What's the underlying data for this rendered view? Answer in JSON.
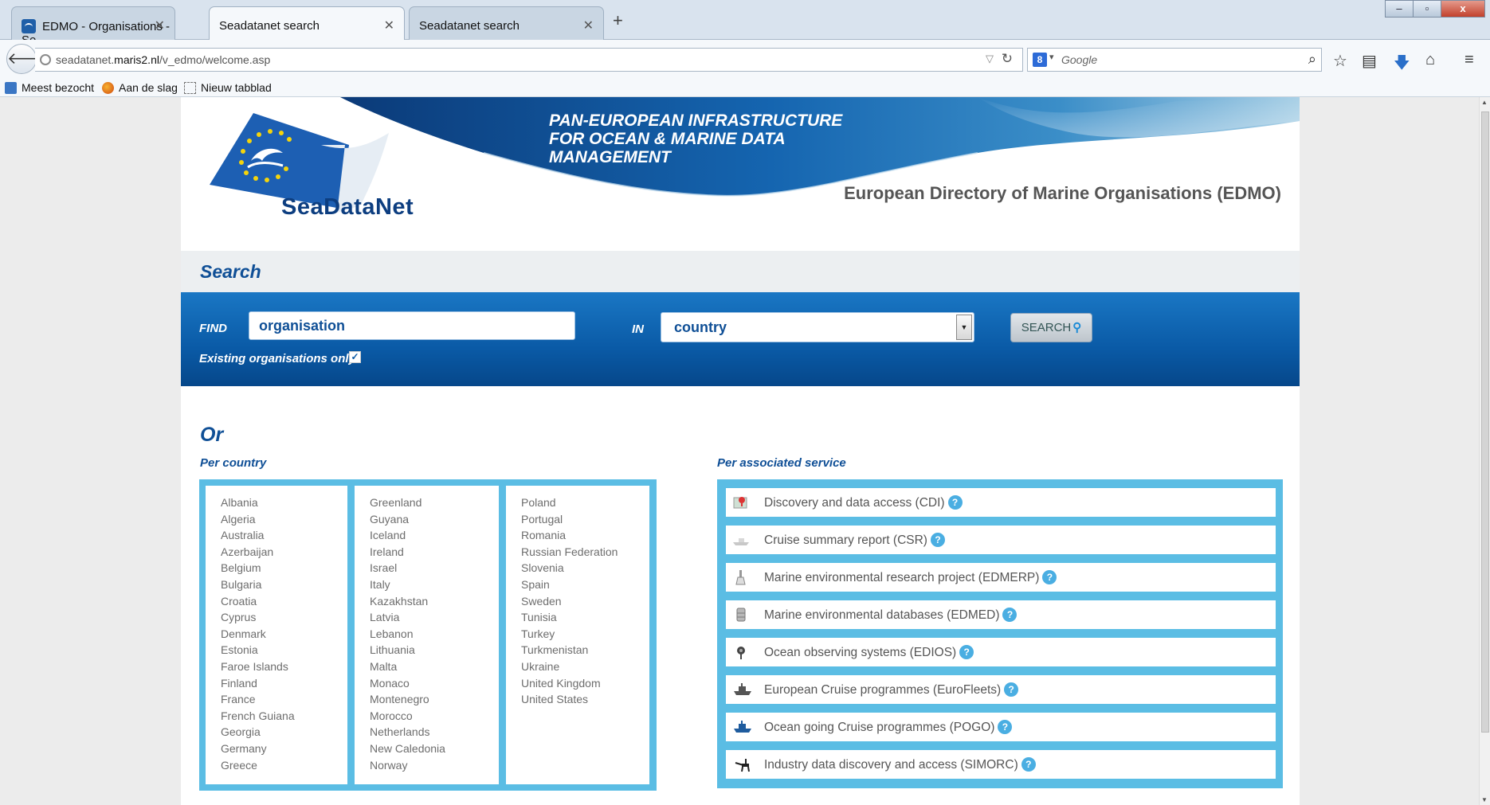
{
  "browser": {
    "tabs": [
      {
        "label": "EDMO - Organisations - Se...",
        "active": false
      },
      {
        "label": "Seadatanet search",
        "active": true
      },
      {
        "label": "Seadatanet search",
        "active": false
      }
    ],
    "new_tab": "+",
    "window_buttons": [
      "–",
      "▫",
      "x"
    ],
    "url_prefix": "seadatanet.",
    "url_host": "maris2.nl",
    "url_path": "/v_edmo/welcome.asp",
    "search_engine_badge": "8",
    "search_placeholder": "Google",
    "bookmarks": [
      "Meest bezocht",
      "Aan de slag",
      "Nieuw tabblad"
    ]
  },
  "header": {
    "logo_text": "SeaDataNet",
    "slogan": [
      "PAN-EUROPEAN INFRASTRUCTURE",
      "FOR OCEAN & MARINE DATA",
      "MANAGEMENT"
    ],
    "directory_title": "European Directory of Marine Organisations (EDMO)"
  },
  "search": {
    "heading": "Search",
    "find_label": "FIND",
    "find_value": "organisation",
    "in_label": "IN",
    "in_value": "country",
    "button_label": "SEARCH",
    "existing_only_label": "Existing organisations only",
    "existing_only_checked": "✓"
  },
  "or_heading": "Or",
  "per_country": {
    "label": "Per country",
    "columns": [
      [
        "Albania",
        "Algeria",
        "Australia",
        "Azerbaijan",
        "Belgium",
        "Bulgaria",
        "Croatia",
        "Cyprus",
        "Denmark",
        "Estonia",
        "Faroe Islands",
        "Finland",
        "France",
        "French Guiana",
        "Georgia",
        "Germany",
        "Greece"
      ],
      [
        "Greenland",
        "Guyana",
        "Iceland",
        "Ireland",
        "Israel",
        "Italy",
        "Kazakhstan",
        "Latvia",
        "Lebanon",
        "Lithuania",
        "Malta",
        "Monaco",
        "Montenegro",
        "Morocco",
        "Netherlands",
        "New Caledonia",
        "Norway"
      ],
      [
        "Poland",
        "Portugal",
        "Romania",
        "Russian Federation",
        "Slovenia",
        "Spain",
        "Sweden",
        "Tunisia",
        "Turkey",
        "Turkmenistan",
        "Ukraine",
        "United Kingdom",
        "United States"
      ]
    ]
  },
  "per_service": {
    "label": "Per associated service",
    "items": [
      {
        "label": "Discovery and data access (CDI)",
        "icon": "map-pin-icon"
      },
      {
        "label": "Cruise summary report (CSR)",
        "icon": "ship-icon"
      },
      {
        "label": "Marine environmental research project (EDMERP)",
        "icon": "flask-icon"
      },
      {
        "label": "Marine environmental databases (EDMED)",
        "icon": "database-icon"
      },
      {
        "label": "Ocean observing systems (EDIOS)",
        "icon": "buoy-icon"
      },
      {
        "label": "European Cruise programmes (EuroFleets)",
        "icon": "vessel-icon"
      },
      {
        "label": "Ocean going Cruise programmes (POGO)",
        "icon": "research-vessel-icon"
      },
      {
        "label": "Industry data discovery and access (SIMORC)",
        "icon": "oil-rig-icon"
      }
    ],
    "help_glyph": "?"
  },
  "colors": {
    "brand_blue": "#0f4f96",
    "panel_blue": "#0a5aa6",
    "frame_cyan": "#5bbde4",
    "help_blue": "#4aaee2"
  }
}
